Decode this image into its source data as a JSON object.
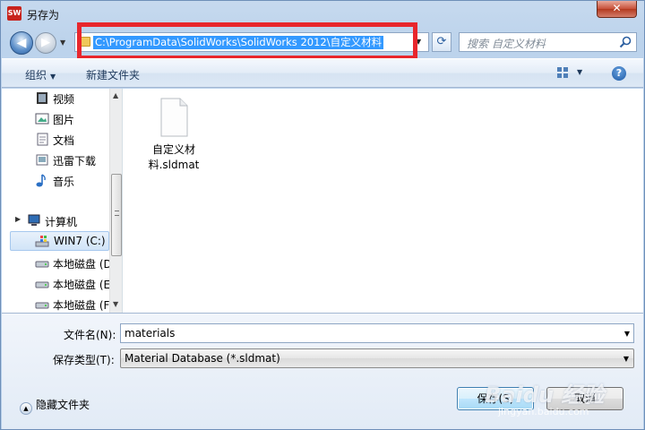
{
  "window": {
    "title": "另存为",
    "app_icon_text": "SW",
    "close_glyph": "✕"
  },
  "address_bar": {
    "path": "C:\\ProgramData\\SolidWorks\\SolidWorks 2012\\自定义材料",
    "refresh_glyph": "⟳"
  },
  "search": {
    "placeholder": "搜索 自定义材料"
  },
  "toolbar": {
    "organize": "组织",
    "new_folder": "新建文件夹",
    "help": "?"
  },
  "nav_pane": {
    "items": [
      {
        "label": "视频",
        "icon": "video-icon"
      },
      {
        "label": "图片",
        "icon": "picture-icon"
      },
      {
        "label": "文档",
        "icon": "document-icon"
      },
      {
        "label": "迅雷下载",
        "icon": "download-icon"
      },
      {
        "label": "音乐",
        "icon": "music-icon"
      },
      {
        "label": "计算机",
        "icon": "computer-icon"
      },
      {
        "label": "WIN7 (C:)",
        "icon": "drive-icon",
        "selected": true
      },
      {
        "label": "本地磁盘 (D",
        "icon": "drive-icon"
      },
      {
        "label": "本地磁盘 (E",
        "icon": "drive-icon"
      },
      {
        "label": "本地磁盘 (F",
        "icon": "drive-icon"
      }
    ]
  },
  "files": [
    {
      "name_line1": "自定义材",
      "name_line2": "料.sldmat",
      "icon": "file-icon"
    }
  ],
  "form": {
    "filename_label": "文件名(N):",
    "filename_value": "materials",
    "filetype_label": "保存类型(T):",
    "filetype_value": "Material Database (*.sldmat)"
  },
  "footer": {
    "hide_folders": "隐藏文件夹",
    "save": "保存(S)",
    "cancel": "取消"
  },
  "watermark": {
    "brand": "Baidu 经验",
    "url": "jingyan.baidu.com"
  },
  "colors": {
    "highlight_border": "#e8262c",
    "selection": "#3399ff"
  }
}
